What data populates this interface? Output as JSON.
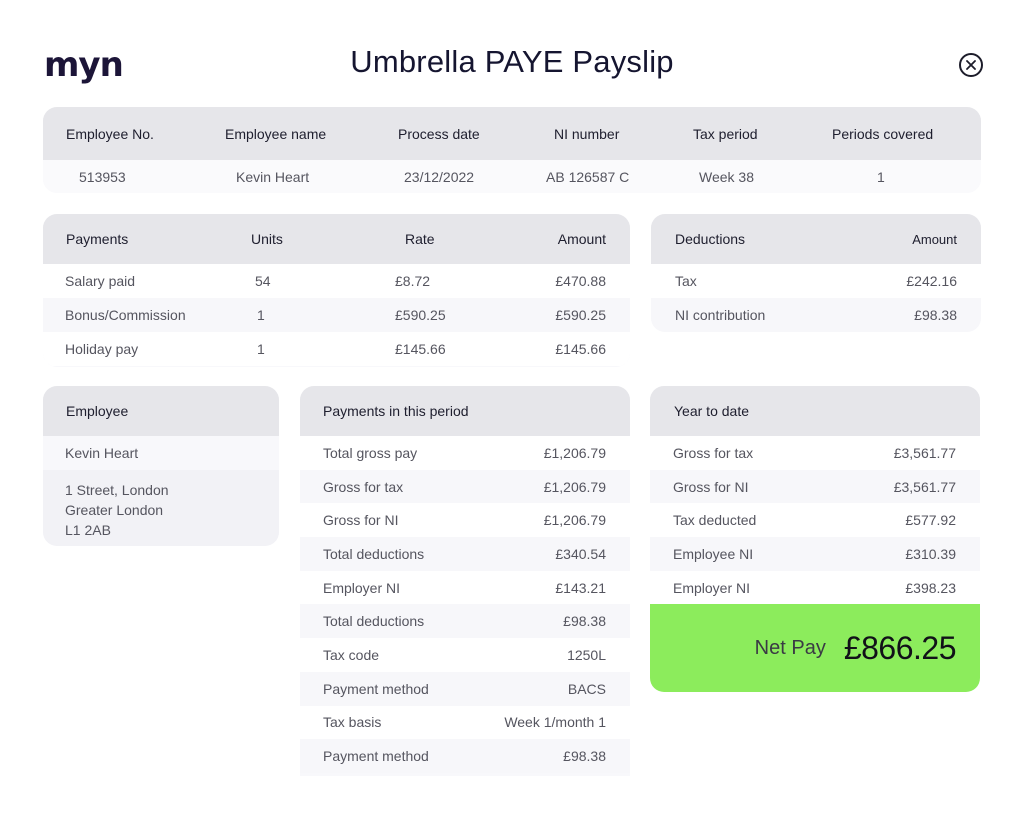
{
  "header": {
    "logo_text": "myn",
    "title": "Umbrella PAYE Payslip"
  },
  "info": {
    "headers": [
      "Employee No.",
      "Employee name",
      "Process date",
      "NI number",
      "Tax period",
      "Periods covered"
    ],
    "values": [
      "513953",
      "Kevin Heart",
      "23/12/2022",
      "AB 126587 C",
      "Week 38",
      "1"
    ]
  },
  "payments": {
    "headers": [
      "Payments",
      "Units",
      "Rate",
      "Amount"
    ],
    "rows": [
      [
        "Salary paid",
        "54",
        "£8.72",
        "£470.88"
      ],
      [
        "Bonus/Commission",
        "1",
        "£590.25",
        "£590.25"
      ],
      [
        "Holiday pay",
        "1",
        "£145.66",
        "£145.66"
      ]
    ]
  },
  "deductions": {
    "headers": [
      "Deductions",
      "Amount"
    ],
    "rows": [
      [
        "Tax",
        "£242.16"
      ],
      [
        "NI contribution",
        "£98.38"
      ]
    ]
  },
  "employee": {
    "title": "Employee",
    "name": "Kevin Heart",
    "address": [
      "1 Street, London",
      "Greater London",
      "L1 2AB"
    ]
  },
  "period": {
    "title": "Payments in this period",
    "rows": [
      [
        "Total gross pay",
        "£1,206.79"
      ],
      [
        "Gross for tax",
        "£1,206.79"
      ],
      [
        "Gross for NI",
        "£1,206.79"
      ],
      [
        "Total deductions",
        "£340.54"
      ],
      [
        "Employer NI",
        "£143.21"
      ],
      [
        "Total deductions",
        "£98.38"
      ],
      [
        "Tax code",
        "1250L"
      ],
      [
        "Payment method",
        "BACS"
      ],
      [
        "Tax basis",
        "Week 1/month 1"
      ],
      [
        "Payment method",
        "£98.38"
      ]
    ]
  },
  "ytd": {
    "title": "Year to date",
    "rows": [
      [
        "Gross for tax",
        "£3,561.77"
      ],
      [
        "Gross for NI",
        "£3,561.77"
      ],
      [
        "Tax deducted",
        "£577.92"
      ],
      [
        "Employee NI",
        "£310.39"
      ],
      [
        "Employer NI",
        "£398.23"
      ]
    ],
    "net_pay_label": "Net Pay",
    "net_pay_value": "£866.25"
  },
  "colors": {
    "net_pay_bg": "#8cec5c",
    "header_bg": "#e6e6ea",
    "brand": "#1c1538",
    "brand_accent": "#7a52d6"
  },
  "icons": {
    "close": "close-circle-icon"
  }
}
